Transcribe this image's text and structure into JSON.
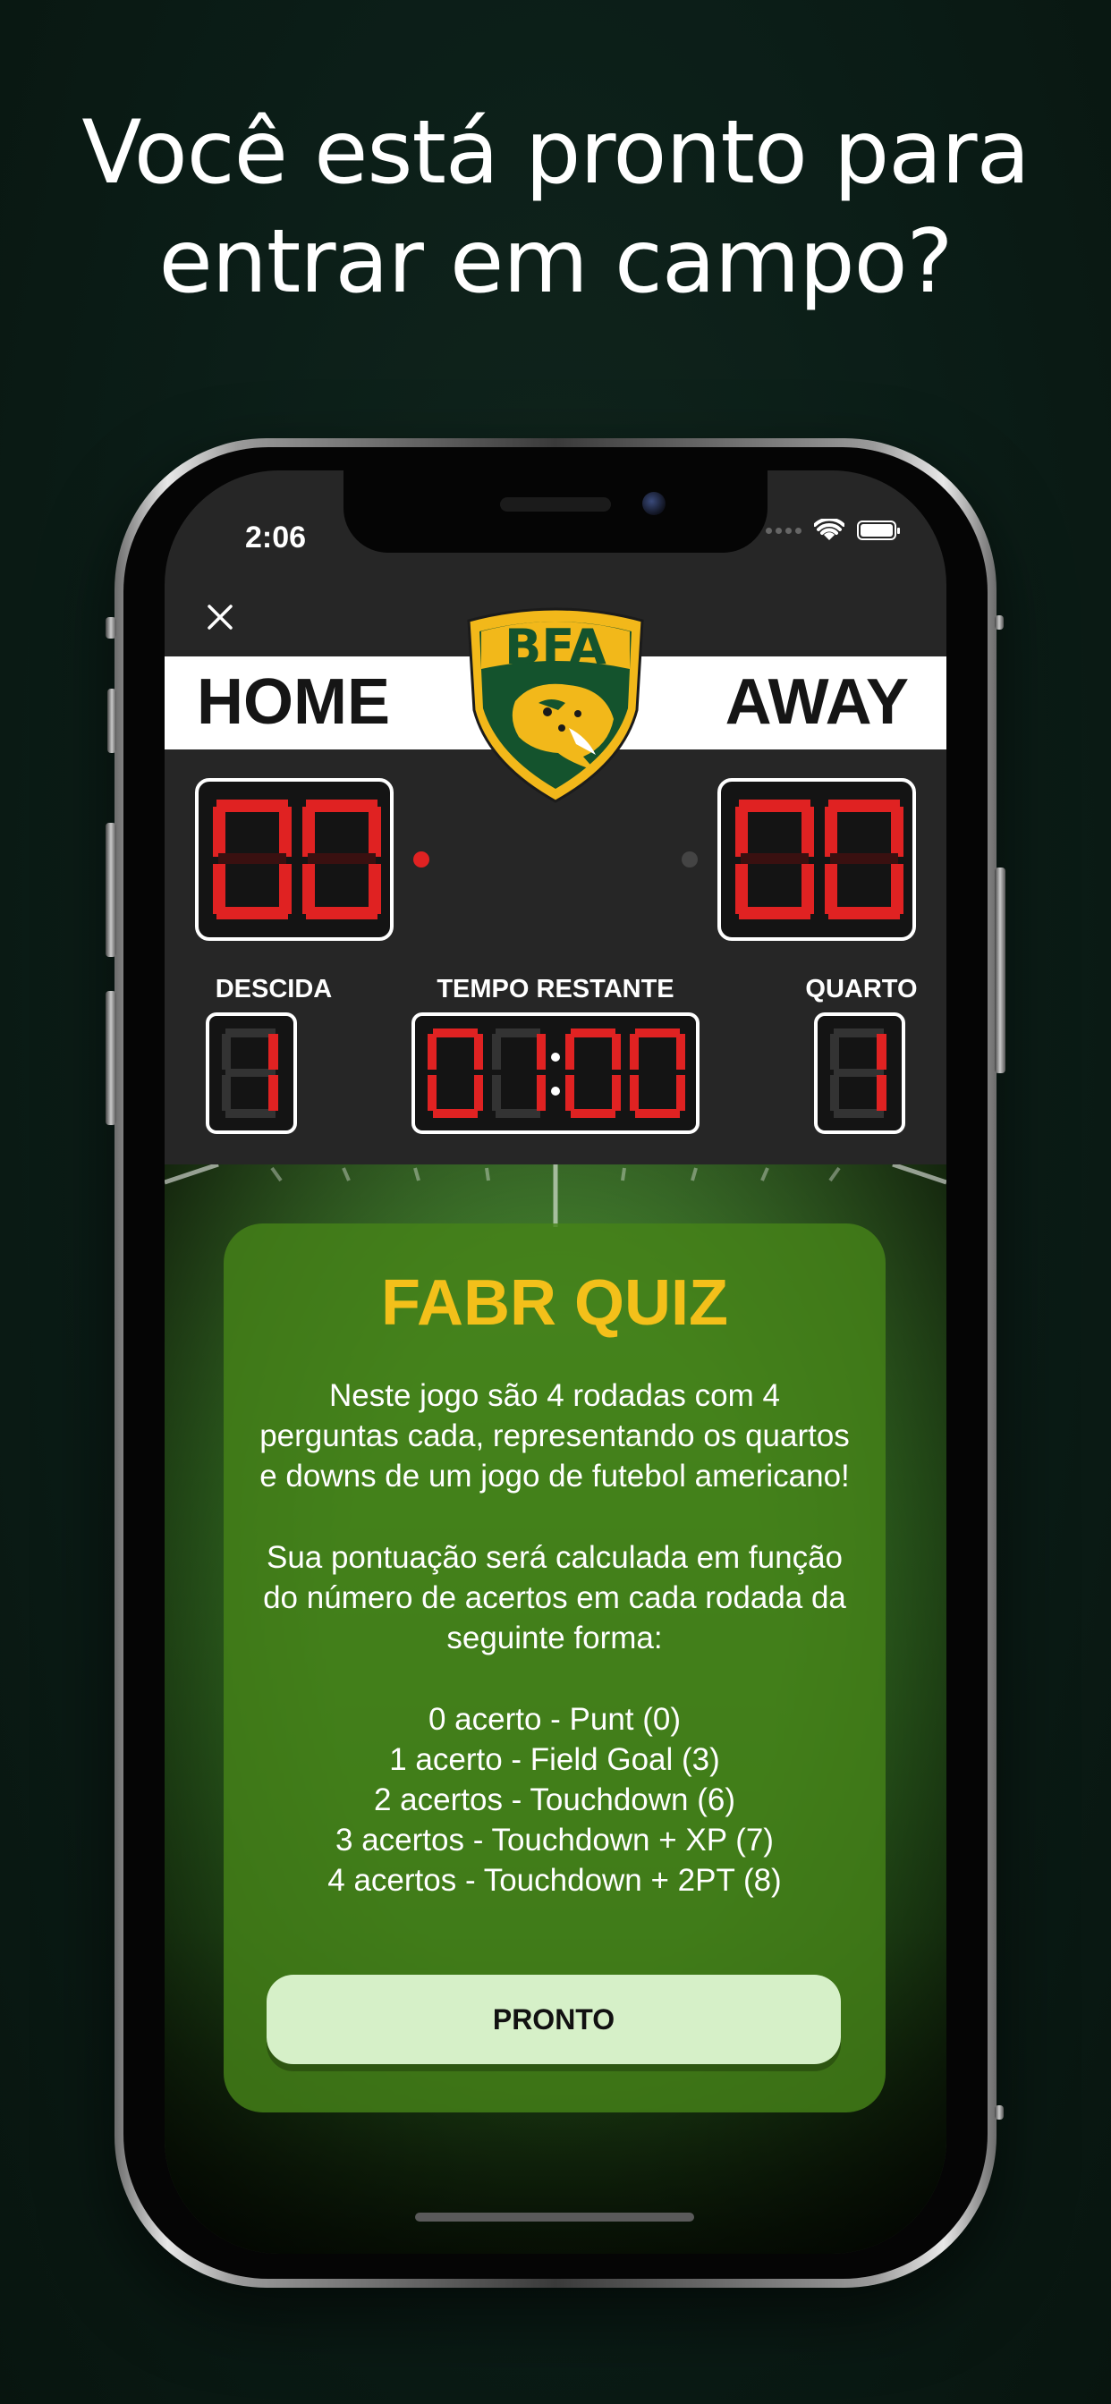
{
  "headline": {
    "line1": "Você está pronto para",
    "line2": "entrar em campo?"
  },
  "status_bar": {
    "time": "2:06",
    "wifi_icon": "wifi-icon",
    "battery_icon": "battery-icon"
  },
  "scoreboard": {
    "home_label": "HOME",
    "away_label": "AWAY",
    "logo_text": "BFA",
    "home_score": "00",
    "away_score": "00",
    "down_label": "DESCIDA",
    "down_value": "1",
    "time_label": "TEMPO RESTANTE",
    "time_value": "01:00",
    "quarter_label": "QUARTO",
    "quarter_value": "1",
    "possession": "home"
  },
  "quiz_card": {
    "title": "FABR QUIZ",
    "paragraph1": "Neste jogo são 4 rodadas com 4 perguntas cada, representando os quartos e downs de um jogo de futebol americano!",
    "paragraph2": "Sua pontuação será calculada em função do número de acertos em cada rodada da seguinte forma:",
    "scoring": [
      "0 acerto - Punt (0)",
      "1 acerto - Field Goal (3)",
      "2 acertos - Touchdown (6)",
      "3 acertos - Touchdown + XP (7)",
      "4 acertos - Touchdown + 2PT (8)"
    ],
    "button_label": "PRONTO"
  },
  "colors": {
    "background": "#0b1d17",
    "led_red": "#e02222",
    "title_yellow": "#f3c01a",
    "card_green": "#46821a",
    "button_green": "#d6f0c8"
  }
}
